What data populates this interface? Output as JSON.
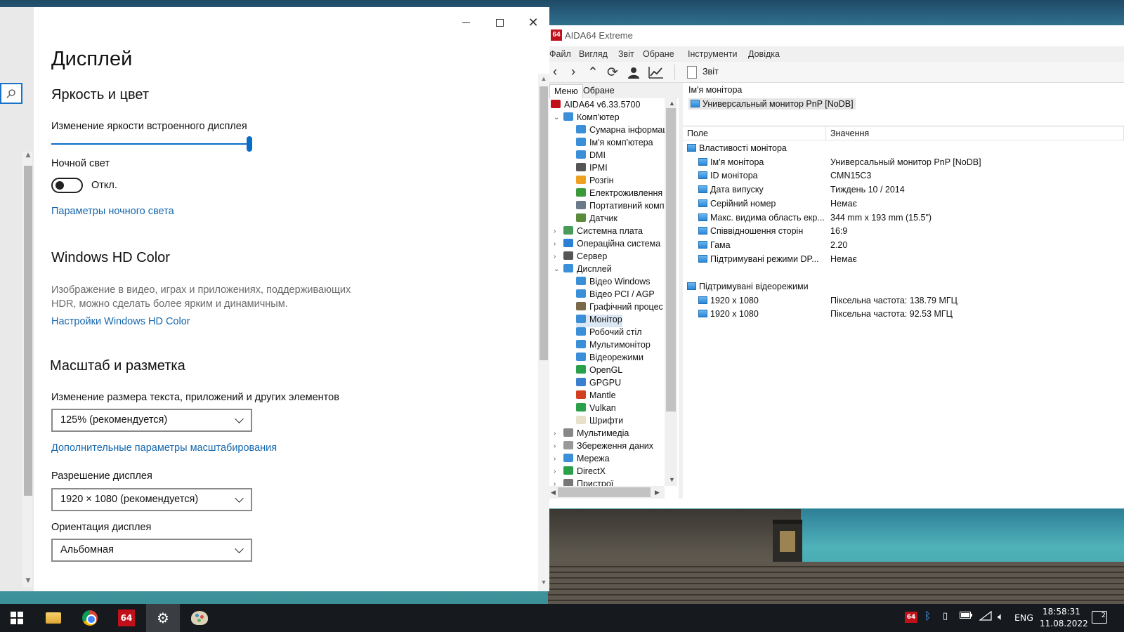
{
  "settings": {
    "title": "Дисплей",
    "brightness_section": "Яркость и цвет",
    "brightness_label": "Изменение яркости встроенного дисплея",
    "brightness_value": 1.0,
    "night_light_label": "Ночной свет",
    "night_light_state": "Откл.",
    "night_light_link": "Параметры ночного света",
    "hd_color_title": "Windows HD Color",
    "hd_color_desc": "Изображение в видео, играх и приложениях, поддерживающих HDR, можно сделать более ярким и динамичным.",
    "hd_color_link": "Настройки Windows HD Color",
    "scale_title": "Масштаб и разметка",
    "scale_label": "Изменение размера текста, приложений и других элементов",
    "scale_value": "125% (рекомендуется)",
    "scale_link": "Дополнительные параметры масштабирования",
    "resolution_label": "Разрешение дисплея",
    "resolution_value": "1920 × 1080 (рекомендуется)",
    "orientation_label": "Ориентация дисплея",
    "orientation_value": "Альбомная"
  },
  "aida": {
    "title": "AIDA64 Extreme",
    "logo": "64",
    "menu": [
      "Файл",
      "Вигляд",
      "Звіт",
      "Обране",
      "Інструменти",
      "Довідка"
    ],
    "toolbar": {
      "icons": [
        "back-icon",
        "forward-icon",
        "up-icon",
        "refresh-icon",
        "user-icon",
        "chart-icon"
      ],
      "report_label": "Звіт"
    },
    "tabs": [
      "Меню",
      "Обране"
    ],
    "tree": [
      {
        "label": "AIDA64 v6.33.5700",
        "icon": "aida-icon",
        "level": 0
      },
      {
        "label": "Комп'ютер",
        "icon": "computer-icon",
        "level": 1
      },
      {
        "label": "Сумарна інформац",
        "icon": "computer-icon",
        "level": 2
      },
      {
        "label": "Ім'я комп'ютера",
        "icon": "computer-icon",
        "level": 2
      },
      {
        "label": "DMI",
        "icon": "computer-icon",
        "level": 2
      },
      {
        "label": "IPMI",
        "icon": "server-icon",
        "level": 2
      },
      {
        "label": "Розгін",
        "icon": "flame-icon",
        "level": 2
      },
      {
        "label": "Електроживлення",
        "icon": "battery-icon",
        "level": 2
      },
      {
        "label": "Портативний комп",
        "icon": "laptop-icon",
        "level": 2
      },
      {
        "label": "Датчик",
        "icon": "sensor-icon",
        "level": 2
      },
      {
        "label": "Системна плата",
        "icon": "motherboard-icon",
        "level": 1
      },
      {
        "label": "Операційна система",
        "icon": "windows-icon",
        "level": 1
      },
      {
        "label": "Сервер",
        "icon": "server-icon",
        "level": 1
      },
      {
        "label": "Дисплей",
        "icon": "monitor-icon",
        "level": 1
      },
      {
        "label": "Відео Windows",
        "icon": "monitor-icon",
        "level": 2
      },
      {
        "label": "Відео PCI / AGP",
        "icon": "monitor-icon",
        "level": 2
      },
      {
        "label": "Графічний процес",
        "icon": "gpu-icon",
        "level": 2
      },
      {
        "label": "Монітор",
        "icon": "monitor-icon",
        "level": 2
      },
      {
        "label": "Робочий стіл",
        "icon": "monitor-icon",
        "level": 2
      },
      {
        "label": "Мультимонітор",
        "icon": "monitor-icon",
        "level": 2
      },
      {
        "label": "Відеорежими",
        "icon": "monitor-icon",
        "level": 2
      },
      {
        "label": "OpenGL",
        "icon": "xbox-icon",
        "level": 2
      },
      {
        "label": "GPGPU",
        "icon": "stack-icon",
        "level": 2
      },
      {
        "label": "Mantle",
        "icon": "mantle-icon",
        "level": 2
      },
      {
        "label": "Vulkan",
        "icon": "xbox-icon",
        "level": 2
      },
      {
        "label": "Шрифти",
        "icon": "font-icon",
        "level": 2
      },
      {
        "label": "Мультимедіа",
        "icon": "speaker-icon",
        "level": 1
      },
      {
        "label": "Збереження даних",
        "icon": "disk-icon",
        "level": 1
      },
      {
        "label": "Мережа",
        "icon": "network-icon",
        "level": 1
      },
      {
        "label": "DirectX",
        "icon": "xbox-icon",
        "level": 1
      },
      {
        "label": "Пристрої",
        "icon": "device-icon",
        "level": 1
      }
    ],
    "selected_item": "Монітор",
    "detail_header_label": "Ім'я монітора",
    "detail_header_value": "Универсальный монитор PnP [NoDB]",
    "columns": [
      "Поле",
      "Значення"
    ],
    "groups": [
      {
        "title": "Властивості монітора",
        "rows": [
          {
            "field": "Ім'я монітора",
            "value": "Универсальный монитор PnP [NoDB]"
          },
          {
            "field": "ID монітора",
            "value": "CMN15C3"
          },
          {
            "field": "Дата випуску",
            "value": "Тиждень 10 / 2014"
          },
          {
            "field": "Серійний номер",
            "value": "Немає"
          },
          {
            "field": "Макс. видима область екр...",
            "value": "344 mm x 193 mm (15.5\")"
          },
          {
            "field": "Співвідношення сторін",
            "value": "16:9"
          },
          {
            "field": "Гама",
            "value": "2.20"
          },
          {
            "field": "Підтримувані режими DP...",
            "value": "Немає"
          }
        ]
      },
      {
        "title": "Підтримувані відеорежими",
        "rows": [
          {
            "field": "1920 x 1080",
            "value": "Піксельна частота: 138.79 МГЦ"
          },
          {
            "field": "1920 x 1080",
            "value": "Піксельна частота: 92.53 МГЦ"
          }
        ]
      }
    ]
  },
  "taskbar": {
    "apps": [
      "windows-start-icon",
      "file-explorer-icon",
      "chrome-icon",
      "aida64-icon",
      "settings-gear-icon",
      "paint-icon"
    ],
    "aida_label": "64",
    "tray_aida": "64",
    "language": "ENG",
    "time": "18:58:31",
    "date": "11.08.2022",
    "notifications": "2"
  },
  "colors": {
    "accent": "#0a6cc7",
    "link": "#1667ad",
    "aida_red": "#c0111b"
  }
}
